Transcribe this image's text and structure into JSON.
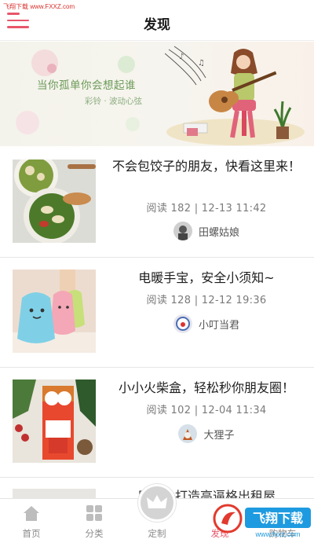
{
  "watermark_top": "飞翔下载 www.FXXZ.com",
  "header": {
    "title": "发现"
  },
  "banner": {
    "line1": "当你孤单你会想起谁",
    "line2": "彩铃 · 波动心弦"
  },
  "articles": [
    {
      "title": "不会包饺子的朋友，快看这里来！",
      "meta": "阅读 182 | 12-13 11:42",
      "author": "田螺姑娘"
    },
    {
      "title": "电暖手宝，安全小须知~",
      "meta": "阅读 128 | 12-12 19:36",
      "author": "小叮当君"
    },
    {
      "title": "小小火柴盒，轻松秒你朋友圈！",
      "meta": "阅读 102 | 12-04 11:34",
      "author": "大狸子"
    },
    {
      "title": "用……打造高逼格出租屋",
      "meta": "",
      "author": ""
    }
  ],
  "tabs": [
    {
      "label": "首页",
      "icon": "home-icon"
    },
    {
      "label": "分类",
      "icon": "grid-icon"
    },
    {
      "label": "定制",
      "icon": "crown-icon"
    },
    {
      "label": "发现",
      "icon": "discover-icon",
      "active": true
    },
    {
      "label": "购物车",
      "icon": "cart-icon"
    }
  ],
  "watermark_bottom": {
    "text": "飞翔下载",
    "url": "www.fxxz.com"
  },
  "colors": {
    "accent": "#e8566b",
    "banner_text": "#6b9a58",
    "tab_inactive": "#8a8a8a"
  }
}
